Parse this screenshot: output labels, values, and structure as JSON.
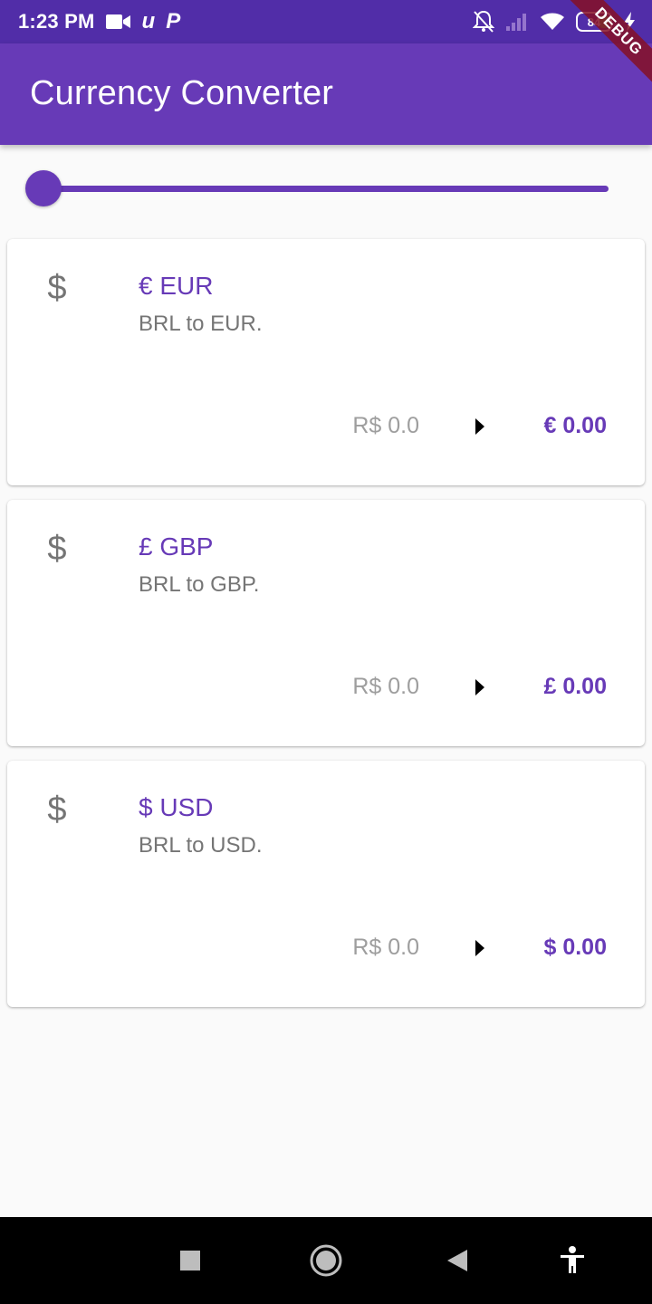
{
  "status_bar": {
    "time": "1:23 PM",
    "left_icons": [
      "video-camera-icon",
      "u-app-icon",
      "p-app-icon"
    ],
    "u_letter": "u",
    "p_letter": "P",
    "right_icons": [
      "muted-bell-icon",
      "signal-icon",
      "wifi-icon",
      "battery-icon",
      "charging-bolt-icon"
    ],
    "battery_level": "84"
  },
  "debug_banner": "DEBUG",
  "app_bar": {
    "title": "Currency Converter"
  },
  "slider": {
    "value": 0
  },
  "cards": [
    {
      "icon": "dollar-icon",
      "icon_glyph": "$",
      "title": "€ EUR",
      "subtitle": "BRL to EUR.",
      "from_value": "R$ 0.0",
      "arrow_icon": "arrow-right-icon",
      "to_value": "€ 0.00"
    },
    {
      "icon": "dollar-icon",
      "icon_glyph": "$",
      "title": "£ GBP",
      "subtitle": "BRL to GBP.",
      "from_value": "R$ 0.0",
      "arrow_icon": "arrow-right-icon",
      "to_value": "£ 0.00"
    },
    {
      "icon": "dollar-icon",
      "icon_glyph": "$",
      "title": "$ USD",
      "subtitle": "BRL to USD.",
      "from_value": "R$ 0.0",
      "arrow_icon": "arrow-right-icon",
      "to_value": "$ 0.00"
    }
  ],
  "nav_bar": {
    "buttons": [
      "recents-square-icon",
      "home-circle-icon",
      "back-triangle-icon",
      "accessibility-icon"
    ]
  },
  "colors": {
    "primary": "#673ab7",
    "primary_dark": "#512da8",
    "background": "#fafafa",
    "card": "#ffffff",
    "secondary_text": "#757575",
    "debug": "#851126"
  }
}
